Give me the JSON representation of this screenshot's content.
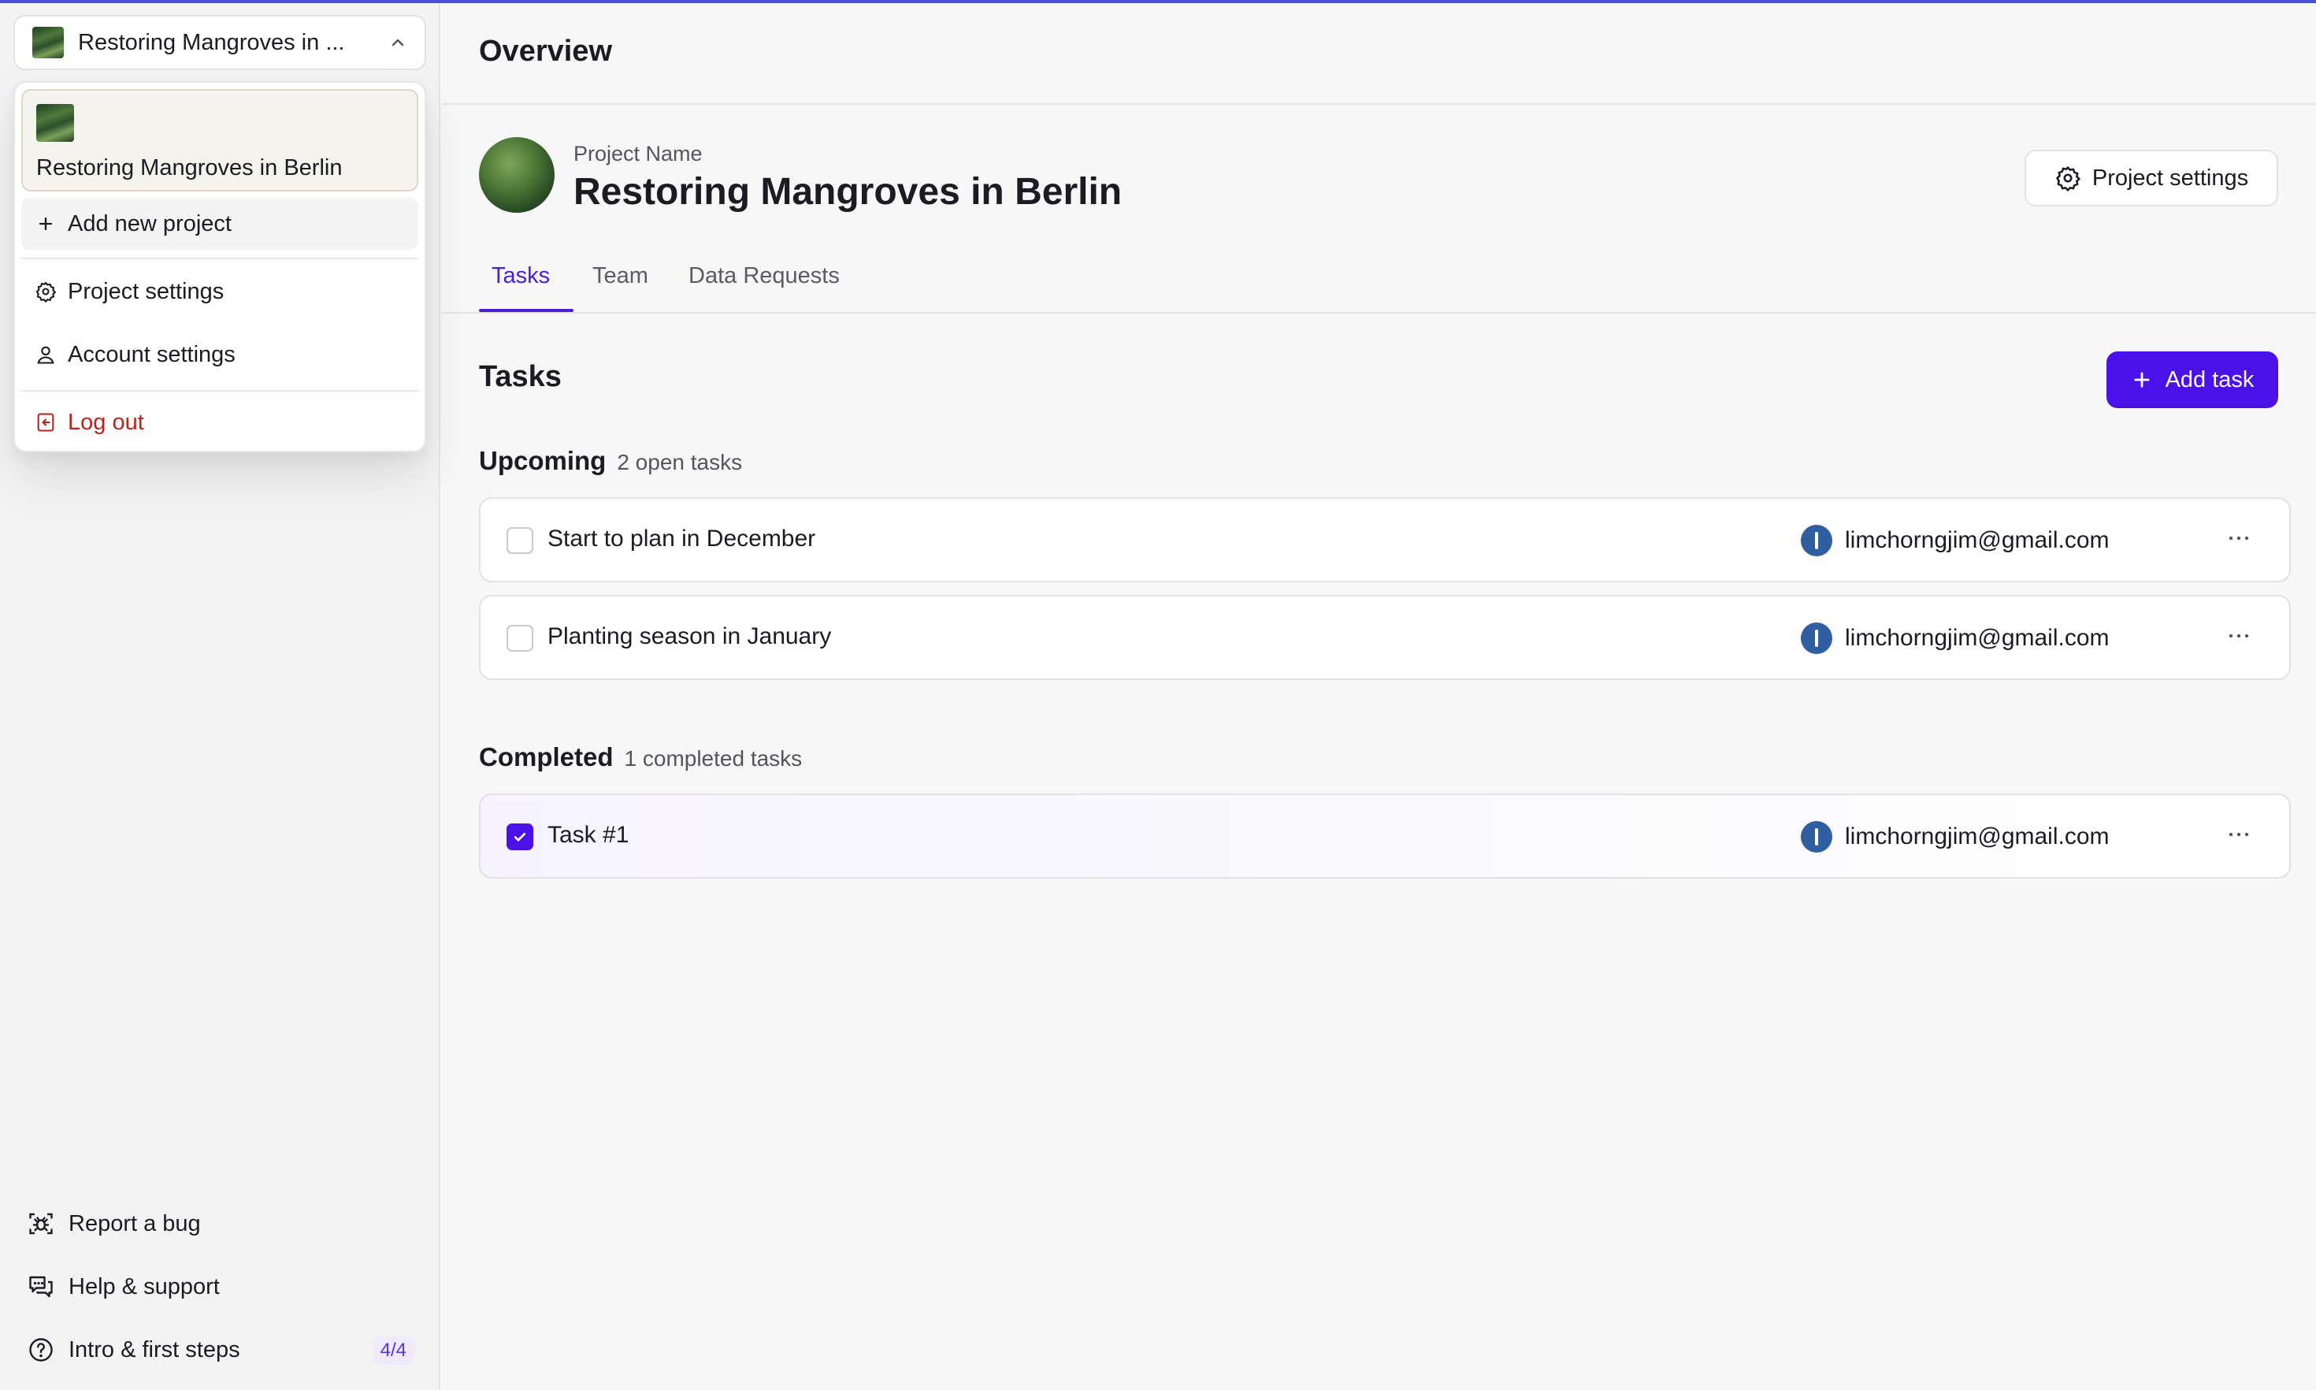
{
  "sidebar": {
    "switcher_name": "Restoring Mangroves in ...",
    "menu": {
      "project_name": "Restoring Mangroves in Berlin",
      "add_new_project": "Add new project",
      "project_settings": "Project settings",
      "account_settings": "Account settings",
      "log_out": "Log out"
    },
    "bottom": {
      "report_bug": "Report a bug",
      "help_support": "Help & support",
      "intro_steps": "Intro & first steps",
      "intro_badge": "4/4"
    }
  },
  "header": {
    "title": "Overview"
  },
  "project": {
    "label": "Project Name",
    "name": "Restoring Mangroves in Berlin",
    "settings_button": "Project settings"
  },
  "tabs": [
    {
      "label": "Tasks",
      "active": true
    },
    {
      "label": "Team",
      "active": false
    },
    {
      "label": "Data Requests",
      "active": false
    }
  ],
  "tasks": {
    "title": "Tasks",
    "add_button": "Add task",
    "upcoming": {
      "heading": "Upcoming",
      "count_text": "2 open tasks",
      "items": [
        {
          "name": "Start to plan in December",
          "assignee": "limchorngjim@gmail.com",
          "done": false
        },
        {
          "name": "Planting season in January",
          "assignee": "limchorngjim@gmail.com",
          "done": false
        }
      ]
    },
    "completed": {
      "heading": "Completed",
      "count_text": "1 completed tasks",
      "items": [
        {
          "name": "Task #1",
          "assignee": "limchorngjim@gmail.com",
          "done": true
        }
      ]
    }
  },
  "colors": {
    "accent": "#4a12e8",
    "tab_active": "#4a1fd8",
    "danger": "#b3261e",
    "avatar": "#2f5fa0"
  },
  "icons": {
    "switcher_chevron": "chevron-up-icon",
    "add": "plus-icon",
    "project_settings": "gear-icon",
    "account_settings": "user-icon",
    "log_out": "logout-icon",
    "report_bug": "bug-icon",
    "help": "chat-bubbles-icon",
    "intro": "question-circle-icon",
    "more": "more-horizontal-icon"
  }
}
